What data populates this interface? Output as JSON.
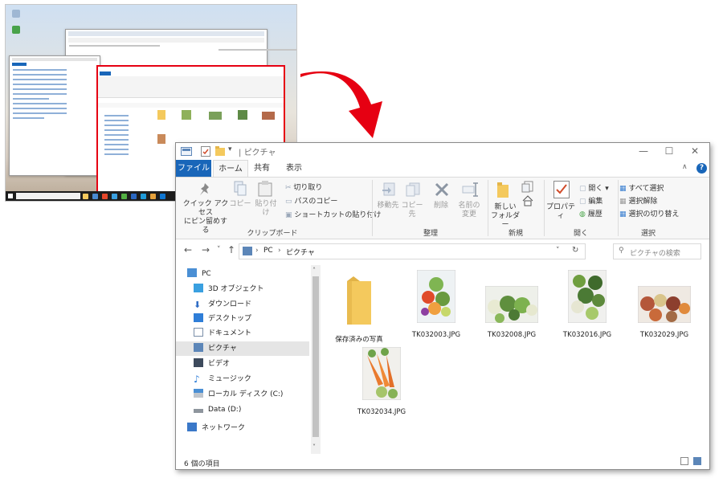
{
  "window": {
    "title": "ピクチャ",
    "controls": {
      "minimize": "—",
      "maximize": "☐",
      "close": "✕"
    }
  },
  "ribbon": {
    "tabs": {
      "file": "ファイル",
      "home": "ホーム",
      "share": "共有",
      "view": "表示"
    },
    "clipboard": {
      "pin_quick_access": "クイック アクセス\nにピン留めする",
      "copy": "コピー",
      "paste": "貼り付け",
      "cut": "切り取り",
      "copy_path": "パスのコピー",
      "paste_shortcut": "ショートカットの貼り付け",
      "group_label": "クリップボード"
    },
    "organize": {
      "move_to": "移動先",
      "copy_to": "コピー先",
      "delete": "削除",
      "rename": "名前の\n変更",
      "group_label": "整理"
    },
    "new": {
      "new_folder": "新しい\nフォルダー",
      "group_label": "新規"
    },
    "open": {
      "properties": "プロパティ",
      "open": "開く",
      "edit": "編集",
      "history": "履歴",
      "group_label": "開く"
    },
    "select": {
      "select_all": "すべて選択",
      "select_none": "選択解除",
      "invert": "選択の切り替え",
      "group_label": "選択"
    }
  },
  "address": {
    "breadcrumb": [
      "PC",
      "ピクチャ"
    ],
    "search_placeholder": "ピクチャの検索"
  },
  "nav": {
    "items": [
      {
        "label": "PC"
      },
      {
        "label": "3D オブジェクト"
      },
      {
        "label": "ダウンロード"
      },
      {
        "label": "デスクトップ"
      },
      {
        "label": "ドキュメント"
      },
      {
        "label": "ピクチャ"
      },
      {
        "label": "ビデオ"
      },
      {
        "label": "ミュージック"
      },
      {
        "label": "ローカル ディスク (C:)"
      },
      {
        "label": "Data (D:)"
      },
      {
        "label": "ネットワーク"
      }
    ],
    "selected": "ピクチャ"
  },
  "files": [
    {
      "name": "保存済みの写真",
      "type": "folder"
    },
    {
      "name": "TK032003.JPG",
      "type": "image"
    },
    {
      "name": "TK032008.JPG",
      "type": "image"
    },
    {
      "name": "TK032016.JPG",
      "type": "image"
    },
    {
      "name": "TK032029.JPG",
      "type": "image"
    },
    {
      "name": "TK032034.JPG",
      "type": "image"
    }
  ],
  "status": {
    "item_count": "6 個の項目"
  },
  "colors": {
    "highlight_red": "#e60012",
    "file_tab_blue": "#1966b9",
    "folder_yellow": "#f4c95d"
  }
}
